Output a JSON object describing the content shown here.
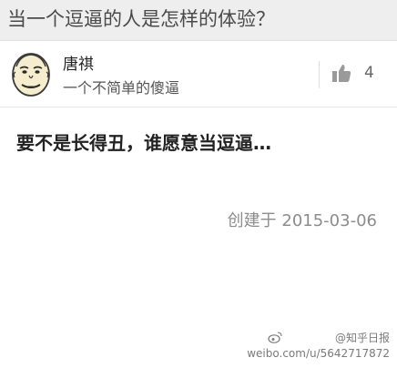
{
  "question": {
    "title": "当一个逗逼的人是怎样的体验？"
  },
  "author": {
    "name": "唐祺",
    "bio": "一个不简单的傻逼",
    "avatar_icon": "meme-face-avatar"
  },
  "vote": {
    "icon": "thumbs-up-icon",
    "count": "4"
  },
  "answer": {
    "text": "要不是长得丑，谁愿意当逗逼…"
  },
  "meta": {
    "created": "创建于 2015-03-06"
  },
  "watermark": {
    "handle": "@知乎日报",
    "url": "weibo.com/u/5642717872"
  },
  "colors": {
    "header_bg": "#eeeeee",
    "text_primary": "#222222",
    "text_secondary": "#8c8c8c"
  }
}
